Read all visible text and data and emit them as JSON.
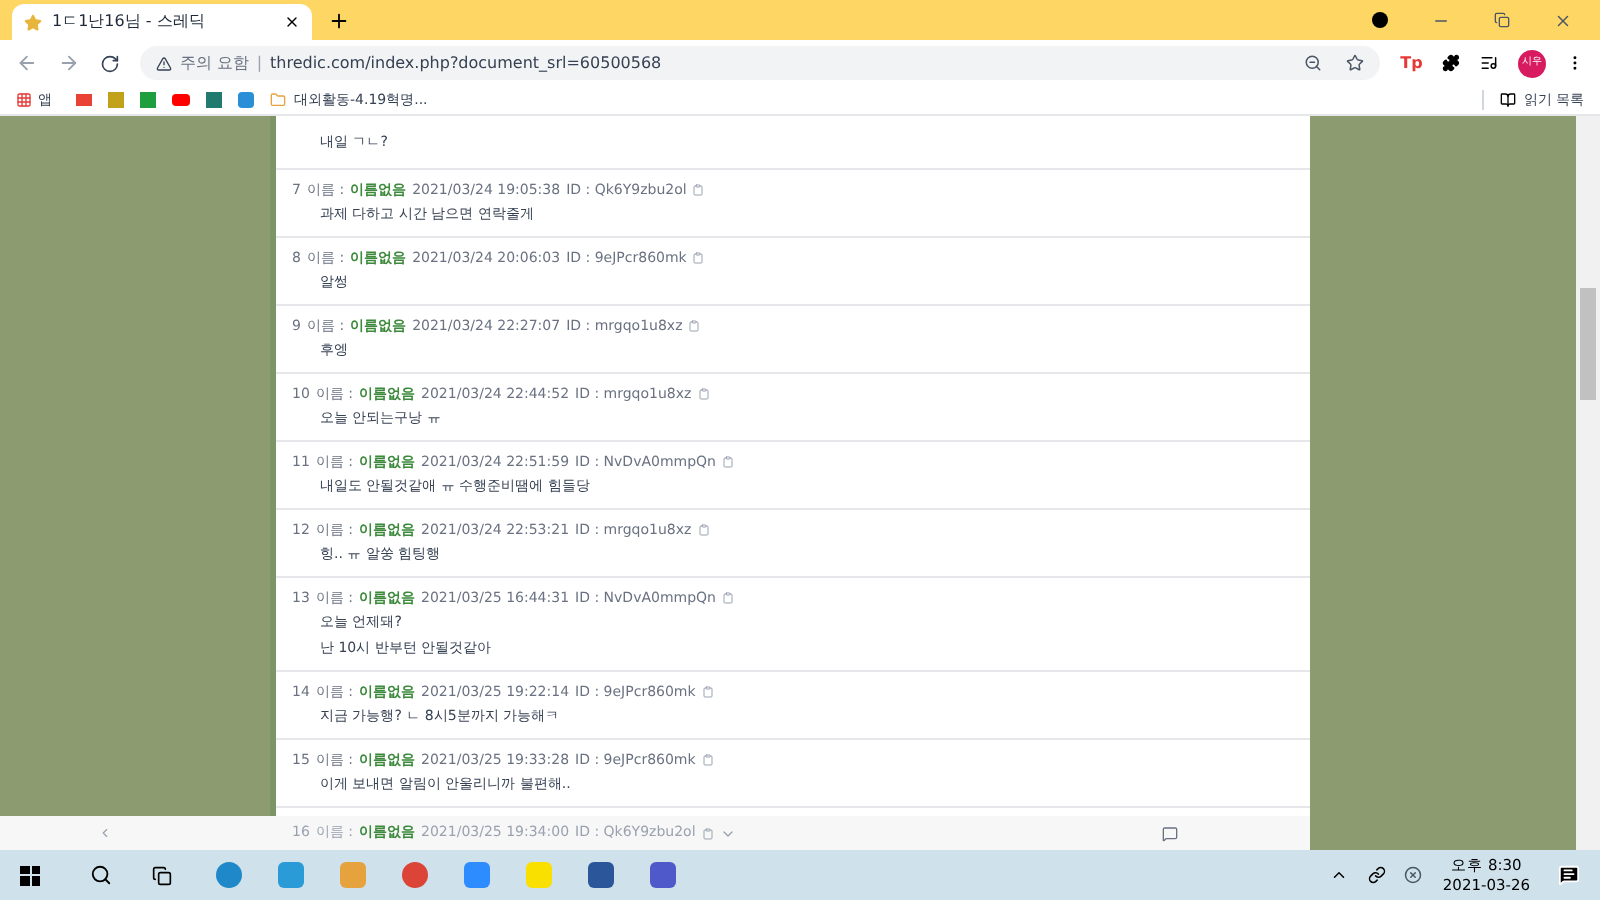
{
  "browser": {
    "tab_title": "1ㄷ1난16님 - 스레딕",
    "warning": "주의 요함",
    "separator": "|",
    "url": "thredic.com/index.php?document_srl=60500568",
    "extension": "Tp",
    "avatar": "시우",
    "bookmarks": [
      {
        "kind": "apps",
        "label": "앱"
      },
      {
        "kind": "folder",
        "label": "대외활동-4.19혁명..."
      }
    ],
    "reading_list": "읽기 목록"
  },
  "comments": [
    {
      "kind": "partial",
      "lines": [
        "내일 ㄱㄴ?"
      ]
    },
    {
      "kind": "full",
      "number": "7",
      "label": "이름 :",
      "name": "이름없음",
      "date": "2021/03/24 19:05:38",
      "id": "ID : Qk6Y9zbu2ol",
      "lines": [
        "과제 다하고 시간 남으면 연락줄게"
      ]
    },
    {
      "kind": "full",
      "number": "8",
      "label": "이름 :",
      "name": "이름없음",
      "date": "2021/03/24 20:06:03",
      "id": "ID : 9eJPcr860mk",
      "lines": [
        "알썽"
      ]
    },
    {
      "kind": "full",
      "number": "9",
      "label": "이름 :",
      "name": "이름없음",
      "date": "2021/03/24 22:27:07",
      "id": "ID : mrgqo1u8xz",
      "lines": [
        "후엥"
      ]
    },
    {
      "kind": "full",
      "number": "10",
      "label": "이름 :",
      "name": "이름없음",
      "date": "2021/03/24 22:44:52",
      "id": "ID : mrgqo1u8xz",
      "lines": [
        "오늘 안되는구낭 ㅠ"
      ]
    },
    {
      "kind": "full",
      "number": "11",
      "label": "이름 :",
      "name": "이름없음",
      "date": "2021/03/24 22:51:59",
      "id": "ID : NvDvA0mmpQn",
      "lines": [
        "내일도 안될것같애 ㅠ 수행준비땜에 힘들당"
      ]
    },
    {
      "kind": "full",
      "number": "12",
      "label": "이름 :",
      "name": "이름없음",
      "date": "2021/03/24 22:53:21",
      "id": "ID : mrgqo1u8xz",
      "lines": [
        "힝.. ㅠ 알쑹 힘팅행"
      ]
    },
    {
      "kind": "full",
      "number": "13",
      "label": "이름 :",
      "name": "이름없음",
      "date": "2021/03/25 16:44:31",
      "id": "ID : NvDvA0mmpQn",
      "lines": [
        "오늘 언제돼?",
        "난 10시 반부턴 안될것같아"
      ]
    },
    {
      "kind": "full",
      "number": "14",
      "label": "이름 :",
      "name": "이름없음",
      "date": "2021/03/25 19:22:14",
      "id": "ID : 9eJPcr860mk",
      "lines": [
        "지금 가능행? ㄴ 8시5분까지 가능해ㅋ"
      ]
    },
    {
      "kind": "full",
      "number": "15",
      "label": "이름 :",
      "name": "이름없음",
      "date": "2021/03/25 19:33:28",
      "id": "ID : 9eJPcr860mk",
      "lines": [
        "이게 보내면 알림이 안울리니까 불편해.."
      ]
    },
    {
      "kind": "faded",
      "number": "16",
      "label": "이름 :",
      "name": "이름없음",
      "date": "2021/03/25 19:34:00",
      "id": "ID : Qk6Y9zbu2ol"
    }
  ],
  "taskbar": {
    "time": "오후 8:30",
    "date": "2021-03-26"
  }
}
